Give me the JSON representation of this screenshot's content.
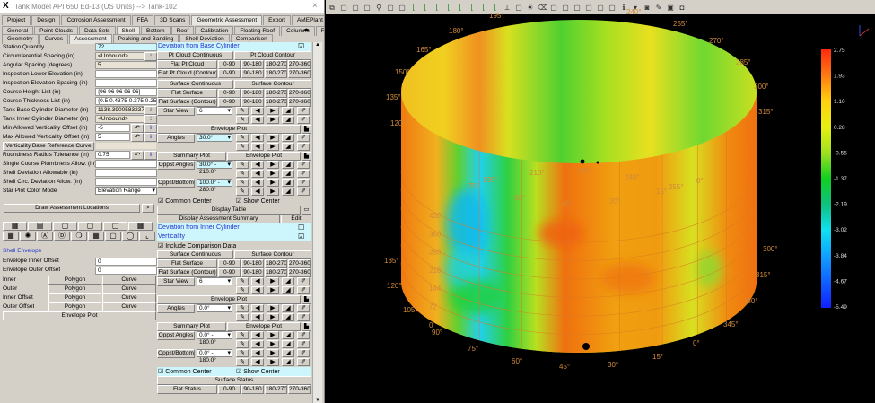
{
  "window": {
    "title": "Tank Model API 650 Ed-13 (US Units) --> Tank-102",
    "close": "×"
  },
  "tabs_row1": [
    "Project",
    "Design",
    "Corrosion Assessment",
    "FEA",
    "3D Scans",
    "Geometric Assessment",
    "Export",
    "AMEPlant"
  ],
  "tabs_row1_active": "Geometric Assessment",
  "tabs_row2": [
    "General",
    "Point Clouds",
    "Data Sets",
    "Shell",
    "Bottom",
    "Roof",
    "Calibration",
    "Floating Roof",
    "Columns",
    "Reporting"
  ],
  "tabs_row2_active": "Shell",
  "tabs_row3": [
    "Geometry",
    "Curves",
    "Assessment",
    "Peaking and Banding",
    "Shell Deviation",
    "Comparison"
  ],
  "tabs_row3_active": "Assessment",
  "fields": [
    {
      "label": "Station Quantity",
      "value": "72",
      "style": "cy"
    },
    {
      "label": "Circumferential Spacing (in)",
      "value": "<Unbound>",
      "style": "ro",
      "btn": "⁝"
    },
    {
      "label": "Angular Spacing (degrees)",
      "value": "5",
      "style": "ro"
    },
    {
      "label": "Inspection Lower Elevation (in)",
      "value": "",
      "style": ""
    },
    {
      "label": "Inspection Elevation Spacing (in)",
      "value": "",
      "style": ""
    },
    {
      "label": "Course Height List (in)",
      "value": "{96 96 96 96 96}",
      "style": ""
    },
    {
      "label": "Course Thickness List (in)",
      "value": "{0.5 0.4375 0.375 0.25 0.25",
      "style": ""
    },
    {
      "label": "Tank Base Cylinder Diameter (in)",
      "value": "1138.390058323723",
      "style": "ro",
      "btn": "⁝"
    },
    {
      "label": "Tank Inner Cylinder Diameter (in)",
      "value": "<Unbound>",
      "style": "ro",
      "btn": "⁝"
    },
    {
      "label": "Min Allowed Verticality Offset (in)",
      "value": "-5",
      "style": "",
      "undo": true
    },
    {
      "label": "Max Allowed Verticality Offset (in)",
      "value": "5",
      "style": "",
      "undo": true
    },
    {
      "label": "Verticality Base Reference Curve",
      "value": "",
      "style": "ro",
      "isbutton": true
    },
    {
      "label": "Roundness Radius Tolerance (in)",
      "value": "0.75",
      "style": "",
      "undo": true
    },
    {
      "label": "Single Course Plumbness Allow. (in)",
      "value": "",
      "style": ""
    },
    {
      "label": "Shell Deviation Allowable (in)",
      "value": "",
      "style": ""
    },
    {
      "label": "Shell Circ. Deviation Allow. (in)",
      "value": "",
      "style": ""
    },
    {
      "label": "Star Plot Color Mode",
      "value": "Elevation Range",
      "style": "",
      "select": true
    }
  ],
  "draw_assessment": "Draw Assessment Locations",
  "icon_rows": [
    [
      "table-icon",
      "list-icon",
      "cylinder-icon",
      "cylinder-top-icon",
      "cylinder-open-icon",
      "grid-icon"
    ],
    [
      "calculator-icon",
      "gear-icon",
      "a-circle-icon",
      "d-circle-icon",
      "marker-icon",
      "layout-icon",
      "shell-icon",
      "ring-icon",
      "axes-icon"
    ]
  ],
  "envelope": {
    "heading": "Shell Envelope",
    "inner_offset_label": "Envelope Inner Offset",
    "inner_offset": "0",
    "outer_offset_label": "Envelope Outer Offset",
    "outer_offset": "0",
    "rows": [
      {
        "label": "Inner",
        "a": "Polygon",
        "b": "Curve"
      },
      {
        "label": "Outer",
        "a": "Polygon",
        "b": "Curve"
      },
      {
        "label": "Inner Offset",
        "a": "Polygon",
        "b": "Curve"
      },
      {
        "label": "Outer Offset",
        "a": "Polygon",
        "b": "Curve"
      }
    ],
    "plot": "Envelope Plot"
  },
  "right_rows": [
    {
      "t": "header",
      "label": "Deviation from Base Cylinder",
      "checked": true
    },
    {
      "t": "pair",
      "a": "Pt Cloud Continuous",
      "b": "Pt Cloud Contour"
    },
    {
      "t": "quad",
      "label": "Flat Pt Cloud",
      "r": [
        "0-90",
        "90-180",
        "180-270",
        "270-360"
      ]
    },
    {
      "t": "quad",
      "label": "Flat Pt Cloud (Contour)",
      "r": [
        "0-90",
        "90-180",
        "180-270",
        "270-360"
      ]
    },
    {
      "t": "gap"
    },
    {
      "t": "pair",
      "a": "Surface Continuous",
      "b": "Surface Contour"
    },
    {
      "t": "quad",
      "label": "Flat Surface",
      "r": [
        "0-90",
        "90-180",
        "180-270",
        "270-360"
      ]
    },
    {
      "t": "quad",
      "label": "Flat Surface (Contour)",
      "r": [
        "0-90",
        "90-180",
        "180-270",
        "270-360"
      ]
    },
    {
      "t": "select",
      "label": "Star View",
      "value": "6"
    },
    {
      "t": "icons"
    },
    {
      "t": "wide",
      "label": "Envelope Plot"
    },
    {
      "t": "select",
      "label": "Angles",
      "value": "30.0°",
      "cy": true
    },
    {
      "t": "icons"
    },
    {
      "t": "pairw",
      "a": "Summary Plot",
      "b": "Envelope Plot"
    },
    {
      "t": "select",
      "label": "Oppst Angles",
      "value": "30.0° - 210.0°",
      "cy": true
    },
    {
      "t": "icons"
    },
    {
      "t": "select",
      "label": "Oppst/Bottom",
      "value": "100.0° - 280.0°",
      "cy": true
    },
    {
      "t": "icons"
    },
    {
      "t": "check2",
      "a": "Common Center",
      "b": "Show Center",
      "cy": false
    },
    {
      "t": "wide",
      "label": "Display Table",
      "icon": "folder-icon"
    },
    {
      "t": "edit",
      "label": "Display Assessment Summary",
      "b": "Edit"
    },
    {
      "t": "header",
      "label": "Deviation from Inner Cylinder",
      "checked": false
    },
    {
      "t": "header",
      "label": "Verticality",
      "checked": true
    },
    {
      "t": "check1",
      "label": "Include Comparison Data"
    },
    {
      "t": "pair",
      "a": "Surface Continuous",
      "b": "Surface Contour"
    },
    {
      "t": "quad",
      "label": "Flat Surface",
      "r": [
        "0-90",
        "90-180",
        "180-270",
        "270-360"
      ]
    },
    {
      "t": "quad",
      "label": "Flat Surface (Contour)",
      "r": [
        "0-90",
        "90-180",
        "180-270",
        "270-360"
      ]
    },
    {
      "t": "select",
      "label": "Star View",
      "value": "6"
    },
    {
      "t": "icons"
    },
    {
      "t": "wide",
      "label": "Envelope Plot"
    },
    {
      "t": "select",
      "label": "Angles",
      "value": "0.0°"
    },
    {
      "t": "icons"
    },
    {
      "t": "pairw",
      "a": "Summary Plot",
      "b": "Envelope Plot"
    },
    {
      "t": "select",
      "label": "Oppst Angles",
      "value": "0.0° - 180.0°"
    },
    {
      "t": "icons"
    },
    {
      "t": "select",
      "label": "Oppst/Bottom",
      "value": "0.0° - 180.0°"
    },
    {
      "t": "icons"
    },
    {
      "t": "check2",
      "a": "Common Center",
      "b": "Show Center",
      "cy": true
    },
    {
      "t": "full",
      "label": "Surface Status"
    },
    {
      "t": "quad",
      "label": "Flat Status",
      "r": [
        "0-90",
        "90-180",
        "180-270",
        "270-360"
      ]
    }
  ],
  "plot_icons": [
    "pencil-icon",
    "camera-icon",
    "play-icon",
    "camera-add-icon",
    "pencil-add-icon"
  ],
  "toolbar_icons": [
    "copy-icon",
    "zoom-extents-icon",
    "zoom-window-icon",
    "pan-icon",
    "zoom-icon",
    "fit-icon",
    "fit-all-icon",
    "view-front-icon",
    "view-back-icon",
    "view-left-icon",
    "view-right-icon",
    "view-top-icon",
    "view-bottom-icon",
    "view-iso1-icon",
    "view-iso2-icon",
    "axis-icon",
    "grid-icon",
    "light-icon",
    "eraser-icon",
    "pick-icon",
    "snapshot-icon",
    "layer-icon",
    "window-icon",
    "copy-window-icon",
    "split-icon",
    "info-icon",
    "dropdown-icon",
    "camera-icon",
    "pen-icon",
    "print-icon",
    "capture-icon"
  ],
  "plot": {
    "colorbar": {
      "labels": [
        "2.75",
        "1.93",
        "1.10",
        "0.28",
        "-0.55",
        "-1.37",
        "-2.19",
        "-3.02",
        "-3.84",
        "-4.67",
        "-5.49"
      ],
      "colors": [
        "#ff2a10",
        "#ff7a10",
        "#ffd010",
        "#e8f010",
        "#a0e020",
        "#10d020",
        "#10c080",
        "#10e0f0",
        "#10a0ff",
        "#1060ff",
        "#1020ff"
      ]
    },
    "outer_angle_labels": [
      "195°",
      "240°",
      "255°",
      "270°",
      "285°",
      "300°",
      "315°",
      "180°",
      "165°",
      "150°",
      "135°",
      "120°",
      "135°",
      "120°",
      "105°",
      "90°",
      "75°",
      "60°",
      "45°",
      "30°",
      "15°",
      "0°",
      "345°",
      "330°",
      "315°",
      "300°"
    ],
    "inner_angle_labels": [
      "210°",
      "225°",
      "240°",
      "255°",
      "0°",
      "15°",
      "195°",
      "75°",
      "60°",
      "45°",
      "30°"
    ],
    "elevation_labels": [
      "432",
      "360",
      "288",
      "216",
      "144",
      "72",
      "0"
    ]
  }
}
